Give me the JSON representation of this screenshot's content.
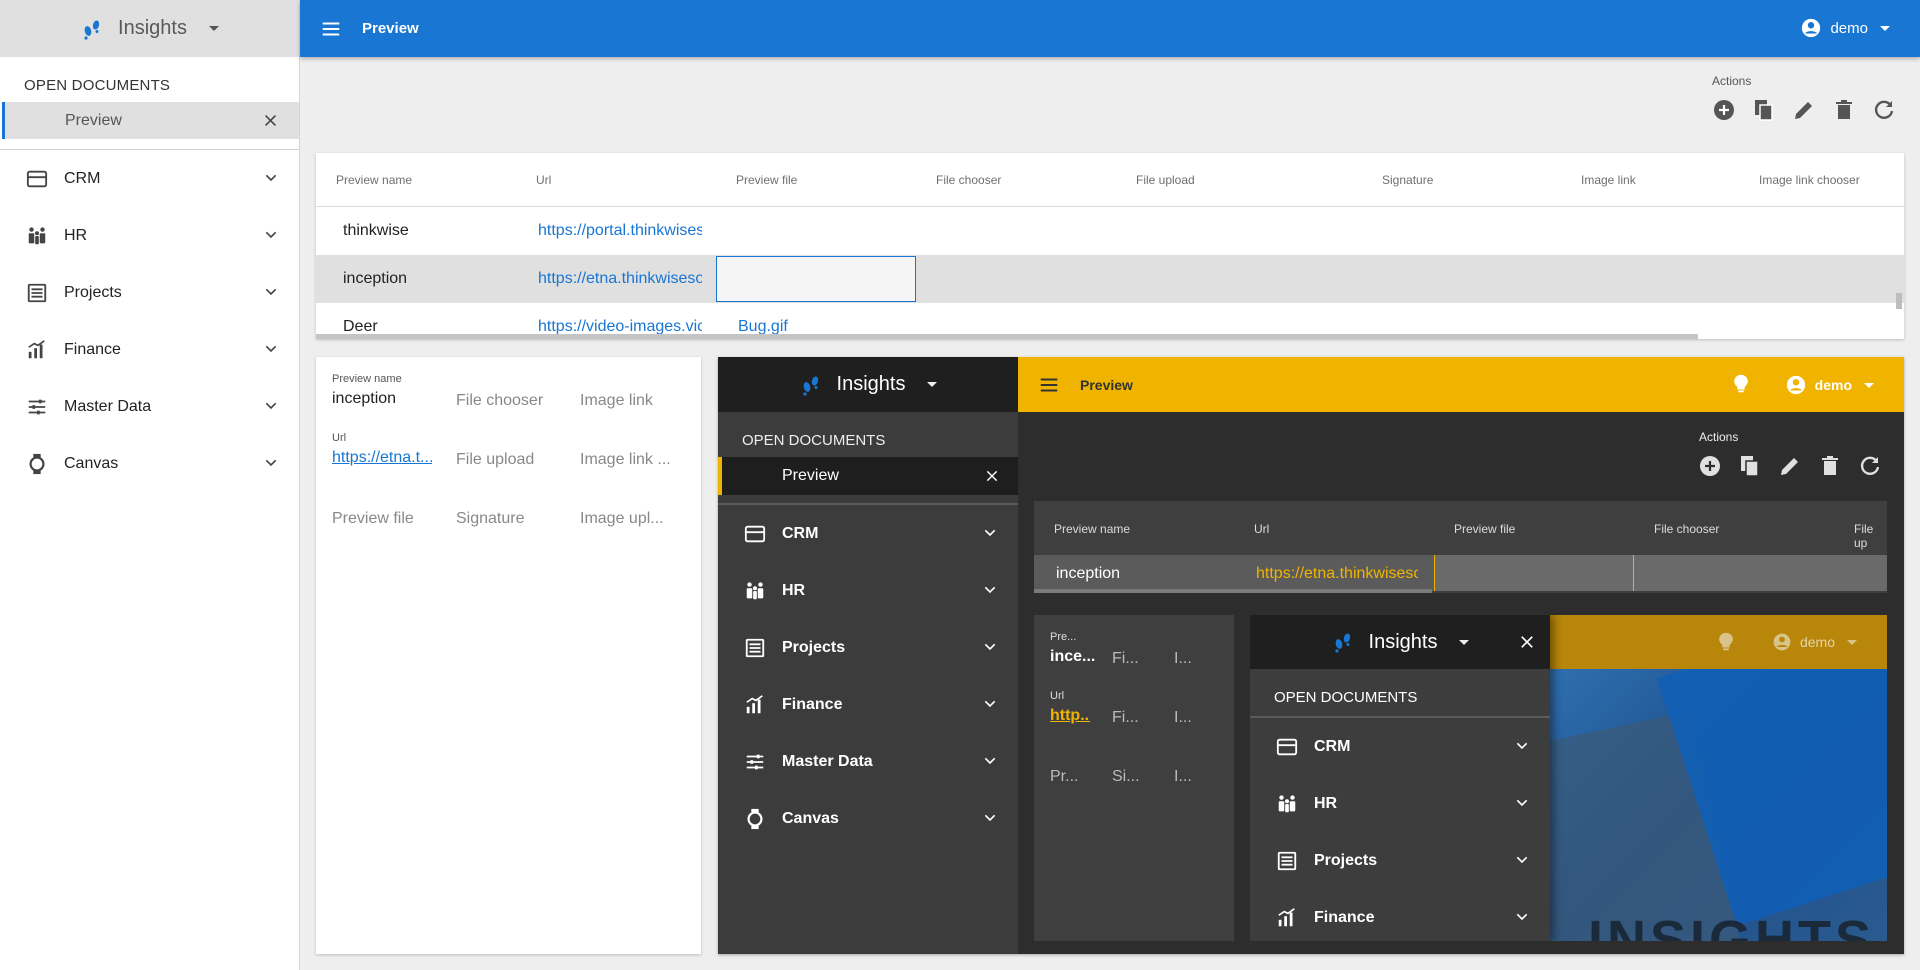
{
  "app": {
    "name": "Insights",
    "user": "demo",
    "page_title": "Preview"
  },
  "sidebar": {
    "open_documents_label": "OPEN DOCUMENTS",
    "open_document": "Preview",
    "nav": [
      {
        "label": "CRM",
        "icon": "crm-icon"
      },
      {
        "label": "HR",
        "icon": "hr-icon"
      },
      {
        "label": "Projects",
        "icon": "projects-icon"
      },
      {
        "label": "Finance",
        "icon": "finance-icon"
      },
      {
        "label": "Master Data",
        "icon": "master-data-icon"
      },
      {
        "label": "Canvas",
        "icon": "canvas-icon"
      }
    ]
  },
  "actions": {
    "label": "Actions",
    "items": [
      "add-icon",
      "copy-icon",
      "edit-icon",
      "delete-icon",
      "refresh-icon"
    ]
  },
  "grid": {
    "columns": [
      "Preview name",
      "Url",
      "Preview file",
      "File chooser",
      "File upload",
      "Signature",
      "Image link",
      "Image link chooser"
    ],
    "rows": [
      {
        "name": "thinkwise",
        "url": "https://portal.thinkwisesoftware.com",
        "preview_file": ""
      },
      {
        "name": "inception",
        "url": "https://etna.thinkwisesoftware.com",
        "preview_file": ""
      },
      {
        "name": "Deer",
        "url": "https://video-images.vice.com",
        "preview_file": "Bug.gif"
      }
    ]
  },
  "form": {
    "preview_name_label": "Preview name",
    "preview_name_value": "inception",
    "url_label": "Url",
    "url_value": "https://etna.t...",
    "file_chooser": "File chooser",
    "file_upload": "File upload",
    "image_link": "Image link",
    "image_link_chooser": "Image link ...",
    "preview_file": "Preview file",
    "signature": "Signature",
    "image_upload": "Image upl..."
  },
  "preview_panel": {
    "app_name": "Insights",
    "page_title": "Preview",
    "user": "demo",
    "open_documents_label": "OPEN DOCUMENTS",
    "open_document": "Preview",
    "nav": [
      "CRM",
      "HR",
      "Projects",
      "Finance",
      "Master Data",
      "Canvas"
    ],
    "actions_label": "Actions",
    "grid_columns": [
      "Preview name",
      "Url",
      "Preview file",
      "File chooser",
      "File up"
    ],
    "grid_row": {
      "name": "inception",
      "url": "https://etna.thinkwisesoftware.com"
    },
    "form": {
      "label1": "Pre...",
      "value1": "ince...",
      "f1": "Fi...",
      "i1": "I...",
      "url_label": "Url",
      "url_value": "http...",
      "f2": "Fi...",
      "i2": "I...",
      "p3": "Pr...",
      "s3": "Si...",
      "i3": "I..."
    },
    "nested": {
      "app_name": "Insights",
      "user": "demo",
      "open_documents_label": "OPEN DOCUMENTS",
      "nav": [
        "CRM",
        "HR",
        "Projects",
        "Finance"
      ],
      "hero_text": "INSIGHTS"
    }
  },
  "colors": {
    "primary": "#1976d2",
    "accent_yellow": "#f0b400",
    "dark_bg": "#212121"
  }
}
